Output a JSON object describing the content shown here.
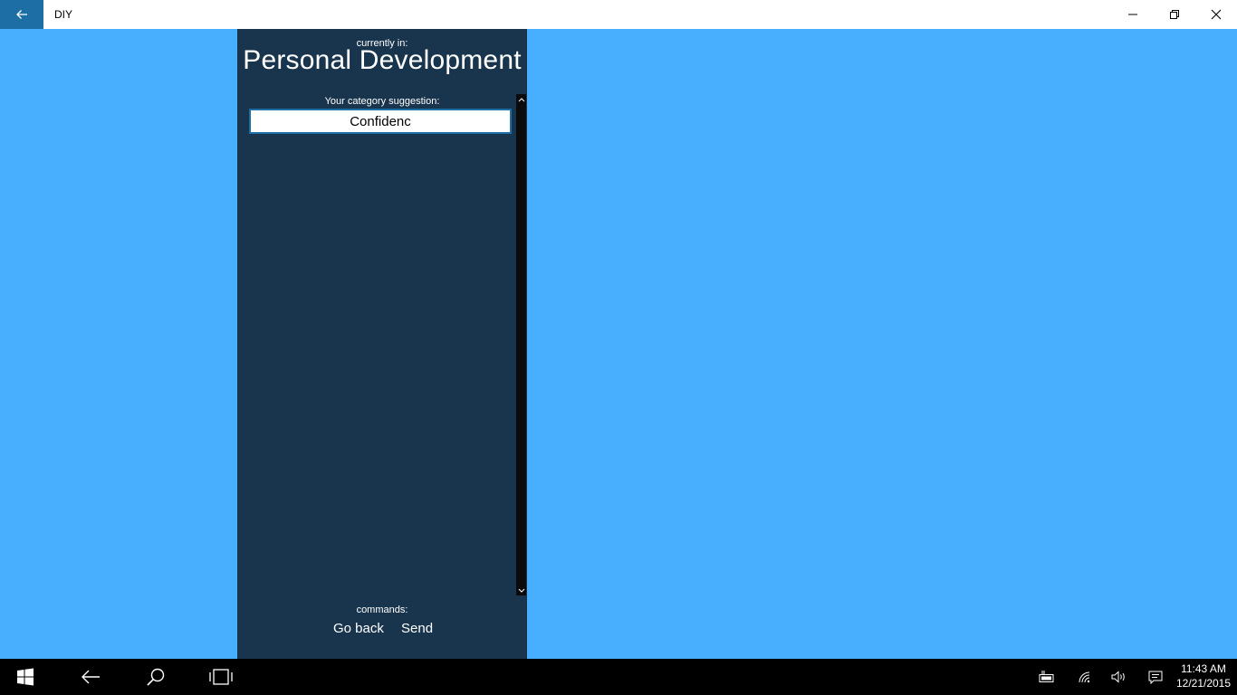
{
  "window": {
    "title": "DIY"
  },
  "panel": {
    "currently_label": "currently in:",
    "category": "Personal Development",
    "suggestion_label": "Your category suggestion:",
    "suggestion_value": "Confidenc",
    "commands_label": "commands:",
    "go_back_label": "Go back",
    "send_label": "Send"
  },
  "taskbar": {
    "time": "11:43 AM",
    "date": "12/21/2015"
  },
  "colors": {
    "background": "#48aefe",
    "panel": "#19354e",
    "accent": "#1c6ea4"
  },
  "icons": {
    "back": "arrow-left-icon",
    "minimize": "minimize-icon",
    "maximize": "restore-icon",
    "close": "close-icon",
    "start": "windows-logo-icon",
    "search": "search-icon",
    "taskview": "task-view-icon",
    "battery": "battery-icon",
    "wifi": "wifi-icon",
    "volume": "volume-icon",
    "action_center": "action-center-icon"
  }
}
